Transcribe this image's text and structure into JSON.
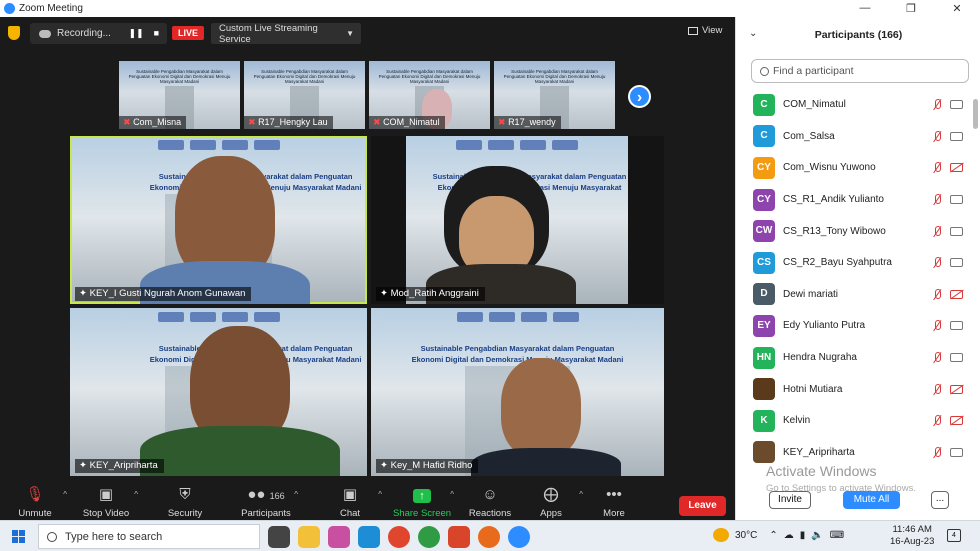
{
  "window": {
    "title": "Zoom Meeting"
  },
  "topbar": {
    "recording": "Recording...",
    "live": "LIVE",
    "stream_label": "Custom Live Streaming Service",
    "view": "View"
  },
  "thumbs": [
    {
      "name": "Com_Misna",
      "slide": "Sustainable Pengabdian Masyarakat dalam Penguatan Ekonomi Digital dan Demokrasi Menuju Masyarakat Madani"
    },
    {
      "name": "R17_Hengky Lau",
      "slide": "Sustainable Pengabdian Masyarakat dalam Penguatan Ekonomi Digital dan Demokrasi Menuju Masyarakat Madani"
    },
    {
      "name": "COM_Nimatul",
      "slide": "Sustainable Pengabdian Masyarakat dalam Penguatan Ekonomi Digital dan Demokrasi Menuju Masyarakat Madani"
    },
    {
      "name": "R17_wendy",
      "slide": "Sustainable Pengabdian Masyarakat dalam Penguatan Ekonomi Digital dan Demokrasi Menuju Masyarakat Madani"
    }
  ],
  "tiles": [
    {
      "name": "KEY_I Gusti Ngurah Anom Gunawan",
      "line1": "Sustainable Pengabdian Masyarakat dalam Penguatan",
      "line2": "Ekonomi Digital dan Demokrasi Menuju Masyarakat Madani"
    },
    {
      "name": "Mod_Ratih Anggraini",
      "line1": "Sustainable Pengabdian Masyarakat dalam Penguatan",
      "line2": "Ekonomi Digital dan Demokrasi Menuju Masyarakat Madani"
    },
    {
      "name": "KEY_Aripriharta",
      "line1": "Sustainable Pengabdian Masyarakat dalam Penguatan",
      "line2": "Ekonomi Digital dan Demokrasi Menuju Masyarakat Madani"
    },
    {
      "name": "Key_M Hafid Ridho",
      "line1": "Sustainable Pengabdian Masyarakat dalam Penguatan",
      "line2": "Ekonomi Digital dan Demokrasi Menuju Masyarakat Madani"
    }
  ],
  "toolbar": {
    "unmute": "Unmute",
    "stop_video": "Stop Video",
    "security": "Security",
    "participants": "Participants",
    "participants_count": "166",
    "chat": "Chat",
    "share": "Share Screen",
    "reactions": "Reactions",
    "apps": "Apps",
    "more": "More",
    "leave": "Leave"
  },
  "panel": {
    "title": "Participants (166)",
    "search_placeholder": "Find a participant",
    "participants": [
      {
        "initials": "C",
        "name": "COM_Nimatul",
        "color": "#23b35a",
        "cam": "on"
      },
      {
        "initials": "C",
        "name": "Com_Salsa",
        "color": "#1f9bd9",
        "cam": "on"
      },
      {
        "initials": "CY",
        "name": "Com_Wisnu Yuwono",
        "color": "#f39c12",
        "cam": "off"
      },
      {
        "initials": "CY",
        "name": "CS_R1_Andik Yulianto",
        "color": "#8e44ad",
        "cam": "on"
      },
      {
        "initials": "CW",
        "name": "CS_R13_Tony Wibowo",
        "color": "#8e44ad",
        "cam": "on"
      },
      {
        "initials": "CS",
        "name": "CS_R2_Bayu Syahputra",
        "color": "#1f9bd9",
        "cam": "on"
      },
      {
        "initials": "D",
        "name": "Dewi mariati",
        "color": "#4a5a66",
        "cam": "off"
      },
      {
        "initials": "EY",
        "name": "Edy Yulianto Putra",
        "color": "#8e44ad",
        "cam": "on"
      },
      {
        "initials": "HN",
        "name": "Hendra Nugraha",
        "color": "#23b35a",
        "cam": "on"
      },
      {
        "initials": "",
        "name": "Hotni Mutiara",
        "color": "#5a3a1a",
        "cam": "off"
      },
      {
        "initials": "K",
        "name": "Kelvin",
        "color": "#23b35a",
        "cam": "off"
      },
      {
        "initials": "",
        "name": "KEY_Aripriharta",
        "color": "#6b4b2b",
        "cam": "on"
      }
    ],
    "watermark": "Activate Windows",
    "watermark_sub": "Go to Settings to activate Windows.",
    "invite": "Invite",
    "mute_all": "Mute All",
    "more": "..."
  },
  "taskbar": {
    "search": "Type here to search",
    "temp": "30°C",
    "time": "11:46 AM",
    "date": "16-Aug-23",
    "notif": "4"
  }
}
